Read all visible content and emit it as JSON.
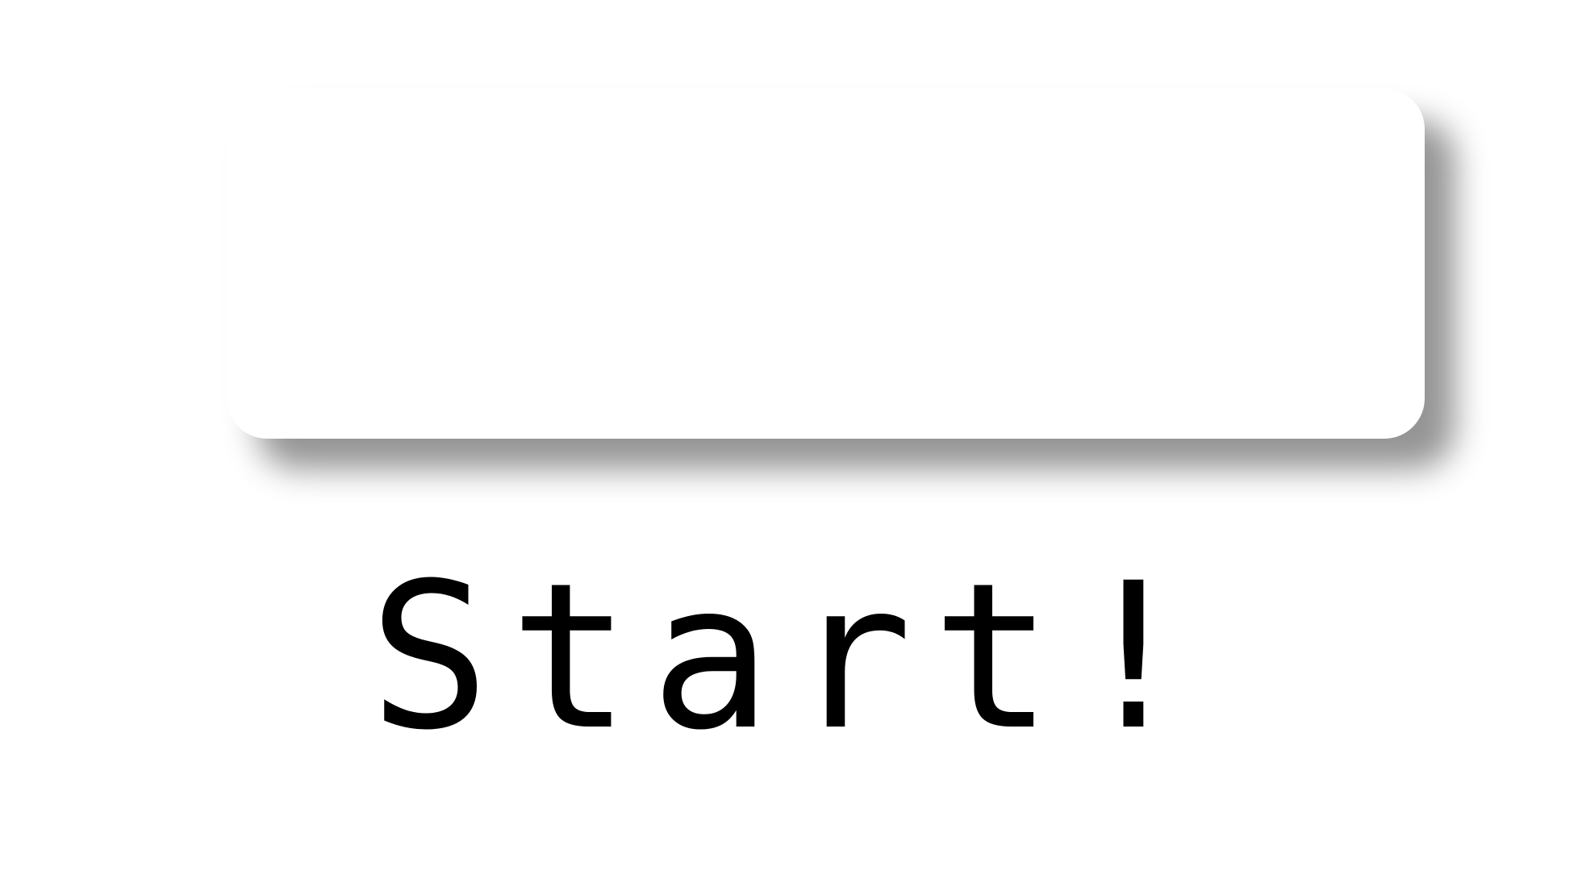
{
  "button": {
    "label": "Start!"
  },
  "colors": {
    "background": "#ffffff",
    "card": "#ffffff",
    "text": "#000000",
    "shadow": "#9a9a9a"
  }
}
